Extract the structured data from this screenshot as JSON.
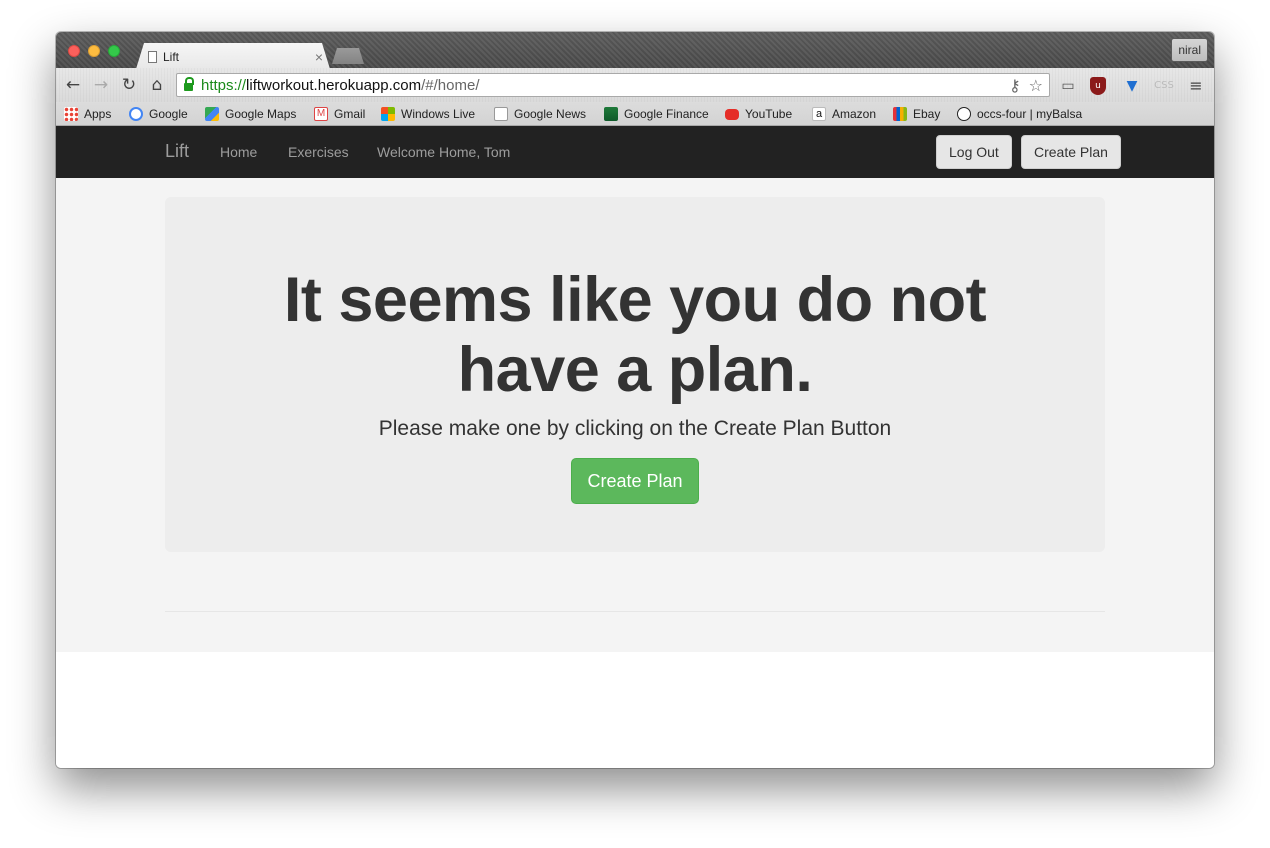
{
  "browser": {
    "tab_title": "Lift",
    "tab_close": "×",
    "profile_name": "niral",
    "url_scheme": "https://",
    "url_host": "liftworkout.herokuapp.com",
    "url_path": "/#/home/",
    "bookmarks": [
      {
        "label": "Apps",
        "icon": "apps-grid-icon"
      },
      {
        "label": "Google",
        "icon": "google-icon"
      },
      {
        "label": "Google Maps",
        "icon": "google-maps-icon"
      },
      {
        "label": "Gmail",
        "icon": "gmail-icon"
      },
      {
        "label": "Windows Live",
        "icon": "windows-icon"
      },
      {
        "label": "Google News",
        "icon": "google-news-icon"
      },
      {
        "label": "Google Finance",
        "icon": "google-finance-icon"
      },
      {
        "label": "YouTube",
        "icon": "youtube-icon"
      },
      {
        "label": "Amazon",
        "icon": "amazon-icon"
      },
      {
        "label": "Ebay",
        "icon": "ebay-icon"
      },
      {
        "label": "occs-four | myBalsa",
        "icon": "smiley-icon"
      }
    ]
  },
  "navbar": {
    "brand": "Lift",
    "links": [
      "Home",
      "Exercises",
      "Welcome Home, Tom"
    ],
    "logout_label": "Log Out",
    "create_plan_label": "Create Plan"
  },
  "main": {
    "headline": "It seems like you do not have a plan.",
    "subtext": "Please make one by clicking on the Create Plan Button",
    "cta_label": "Create Plan"
  },
  "colors": {
    "navbar_bg": "#222222",
    "success_button": "#5cb85c",
    "jumbotron_bg": "#ededed"
  }
}
